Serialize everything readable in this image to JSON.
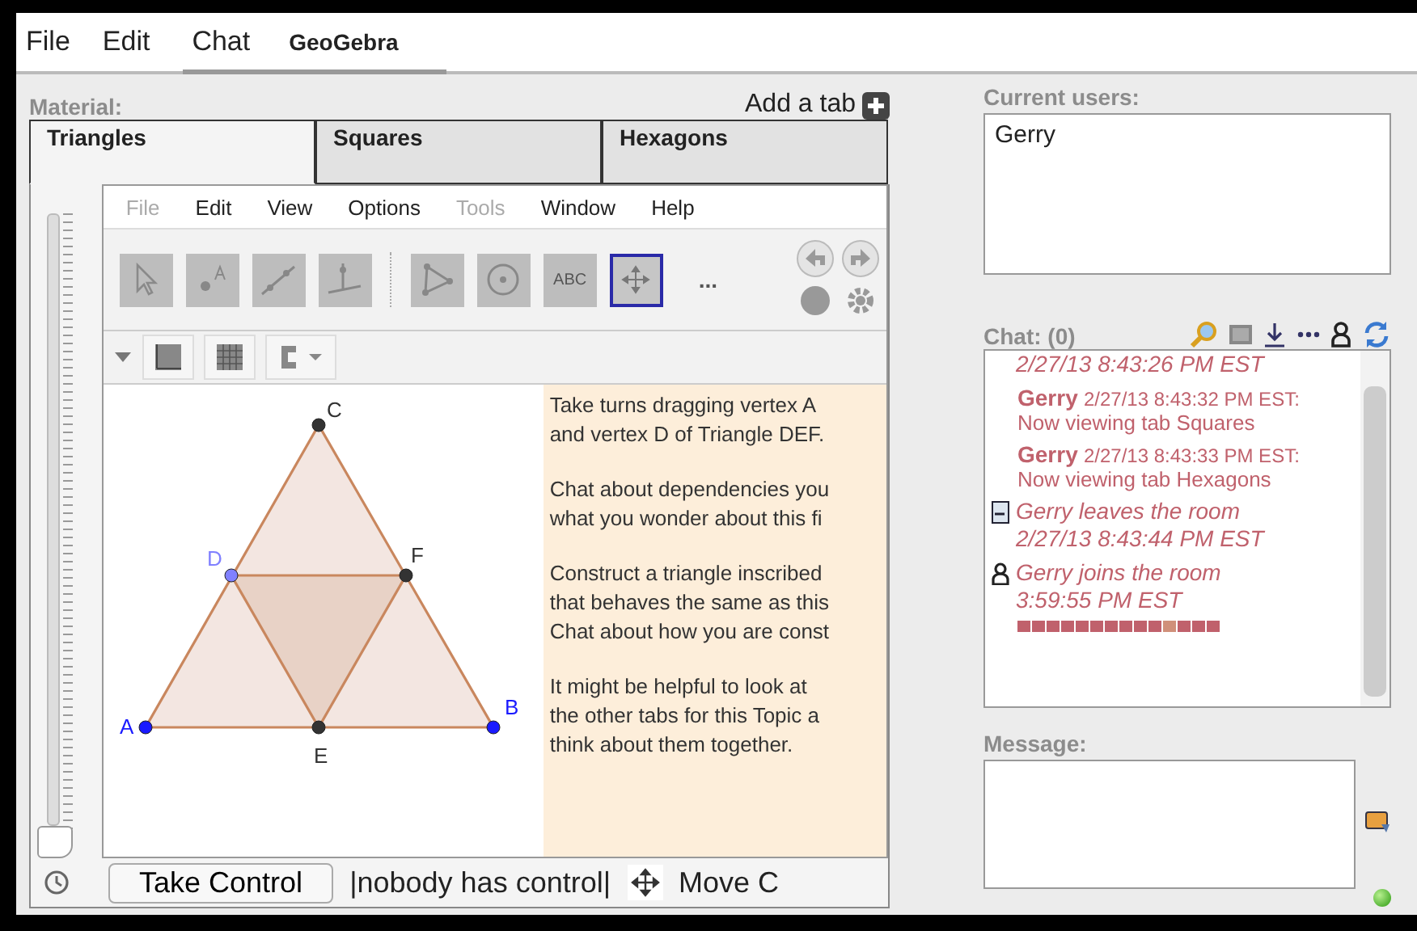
{
  "menu_bar": {
    "menus": [
      {
        "label": "File"
      },
      {
        "label": "Edit"
      }
    ],
    "tabs": [
      {
        "label": "Chat",
        "selected": false
      },
      {
        "label": "GeoGebra",
        "selected": true
      }
    ]
  },
  "material": {
    "label": "Material:",
    "add_tab": "Add a tab",
    "tabs": [
      {
        "label": "Triangles",
        "selected": true
      },
      {
        "label": "Squares",
        "selected": false
      },
      {
        "label": "Hexagons",
        "selected": false
      }
    ],
    "zoom_slider": {
      "level": 0
    },
    "geogebra": {
      "menus": [
        {
          "label": "File",
          "disabled": true
        },
        {
          "label": "Edit",
          "disabled": false
        },
        {
          "label": "View",
          "disabled": false
        },
        {
          "label": "Options",
          "disabled": false
        },
        {
          "label": "Tools",
          "disabled": true
        },
        {
          "label": "Window",
          "disabled": false
        },
        {
          "label": "Help",
          "disabled": false
        }
      ],
      "tools": [
        {
          "kind": "pointer",
          "selected": false
        },
        {
          "kind": "point",
          "selected": false
        },
        {
          "kind": "line",
          "selected": false
        },
        {
          "kind": "perpendicular",
          "selected": false
        },
        {
          "kind": "polygon",
          "selected": false
        },
        {
          "kind": "circle",
          "selected": false
        },
        {
          "kind": "text",
          "label": "ABC",
          "selected": false
        },
        {
          "kind": "move-view",
          "selected": true
        }
      ],
      "more": "...",
      "points": [
        {
          "label": "A",
          "color": "#1a1aff"
        },
        {
          "label": "B",
          "color": "#1a1aff"
        },
        {
          "label": "C",
          "color": "#333333"
        },
        {
          "label": "D",
          "color": "#8080ff"
        },
        {
          "label": "E",
          "color": "#333333"
        },
        {
          "label": "F",
          "color": "#333333"
        }
      ],
      "instructions": [
        [
          "Take turns dragging vertex A",
          "and vertex D of Triangle DEF."
        ],
        [
          "Chat about dependencies you",
          "what you wonder about this fi"
        ],
        [
          "Construct a triangle inscribed",
          "that behaves the same as this",
          "Chat about how you are const"
        ],
        [
          "It might be helpful to look at",
          "the other tabs for this Topic a",
          "think about them together."
        ]
      ]
    },
    "control_bar": {
      "button": "Take Control",
      "status": "|nobody has control|",
      "move": "Move C"
    }
  },
  "users": {
    "label": "Current users:",
    "items": [
      "Gerry"
    ]
  },
  "chat": {
    "label": "Chat: (0)",
    "entries": [
      {
        "kind": "timestamp",
        "text": "2/27/13 8:43:26 PM EST"
      },
      {
        "kind": "message",
        "user": "Gerry",
        "time": "2/27/13 8:43:32 PM EST:",
        "text": "Now viewing tab Squares"
      },
      {
        "kind": "message",
        "user": "Gerry",
        "time": "2/27/13 8:43:33 PM EST:",
        "text": "Now viewing tab Hexagons"
      },
      {
        "kind": "leave",
        "text": "Gerry leaves the room 2/27/13 8:43:44 PM EST"
      },
      {
        "kind": "join",
        "text": "Gerry joins the room 3:59:55 PM EST"
      }
    ],
    "awareness": [
      {
        "color": "#c0616c"
      },
      {
        "color": "#c0616c"
      },
      {
        "color": "#c0616c"
      },
      {
        "color": "#c0616c"
      },
      {
        "color": "#c0616c"
      },
      {
        "color": "#c0616c"
      },
      {
        "color": "#c0616c"
      },
      {
        "color": "#c0616c"
      },
      {
        "color": "#c0616c"
      },
      {
        "color": "#c0616c"
      },
      {
        "color": "#d0907a"
      },
      {
        "color": "#c0616c"
      },
      {
        "color": "#c0616c"
      },
      {
        "color": "#c0616c"
      }
    ]
  },
  "message": {
    "label": "Message:"
  }
}
